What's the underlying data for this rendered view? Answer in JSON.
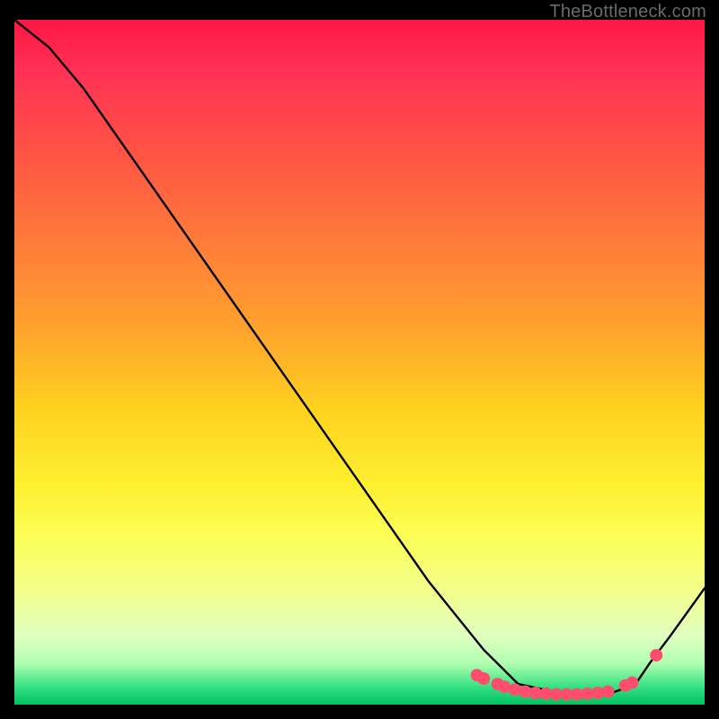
{
  "watermark": "TheBottleneck.com",
  "chart_data": {
    "type": "line",
    "title": "",
    "xlabel": "",
    "ylabel": "",
    "xlim": [
      0,
      1
    ],
    "ylim": [
      0,
      1
    ],
    "series": [
      {
        "name": "curve",
        "x": [
          0.0,
          0.05,
          0.1,
          0.6,
          0.68,
          0.73,
          0.8,
          0.86,
          0.9,
          0.92,
          0.95,
          1.0
        ],
        "y": [
          1.0,
          0.96,
          0.9,
          0.18,
          0.08,
          0.03,
          0.015,
          0.015,
          0.03,
          0.06,
          0.1,
          0.17
        ]
      }
    ],
    "markers": {
      "name": "dots",
      "color": "#ff4d6d",
      "x": [
        0.67,
        0.68,
        0.7,
        0.71,
        0.725,
        0.74,
        0.755,
        0.77,
        0.785,
        0.8,
        0.815,
        0.83,
        0.845,
        0.86,
        0.885,
        0.895,
        0.93
      ],
      "y": [
        0.043,
        0.038,
        0.03,
        0.026,
        0.022,
        0.019,
        0.017,
        0.016,
        0.015,
        0.015,
        0.015,
        0.016,
        0.017,
        0.019,
        0.028,
        0.032,
        0.072
      ]
    },
    "colors": {
      "line": "#000000",
      "marker": "#ff4d6d",
      "gradient_top": "#ff1744",
      "gradient_bottom": "#00c060"
    }
  }
}
